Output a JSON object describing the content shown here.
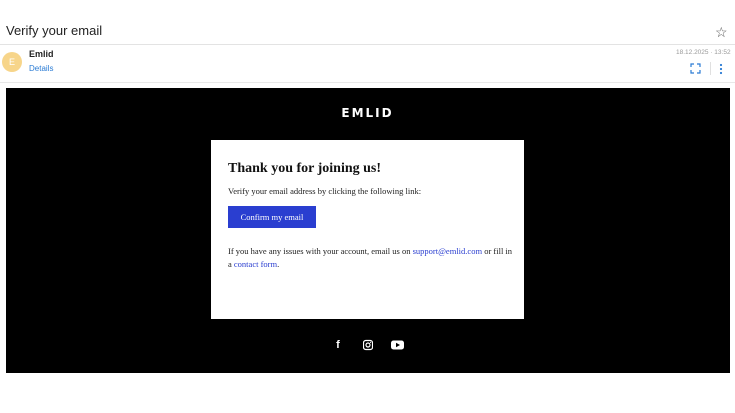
{
  "header": {
    "subject": "Verify your email",
    "star_icon": "star-icon"
  },
  "sender": {
    "avatar_letter": "E",
    "name": "Emlid",
    "details_label": "Details",
    "date": "18.12.2025 · 13:52",
    "expand_icon": "expand-icon",
    "menu_icon": "more-vertical-icon"
  },
  "email": {
    "logo": "EMLID",
    "title": "Thank you for joining us!",
    "intro": "Verify your email address by clicking the following link:",
    "button_label": "Confirm my email",
    "issues_prefix": "If you have any issues with your account, email us on ",
    "support_email": "support@emlid.com",
    "issues_middle": " or fill in a ",
    "contact_form": "contact form",
    "issues_suffix": ".",
    "social_icons": [
      "facebook-icon",
      "instagram-icon",
      "youtube-icon"
    ]
  },
  "colors": {
    "accent": "#2a3ed0",
    "link": "#2a7bd4",
    "avatar": "#f7d58a",
    "email_bg": "#000000"
  }
}
